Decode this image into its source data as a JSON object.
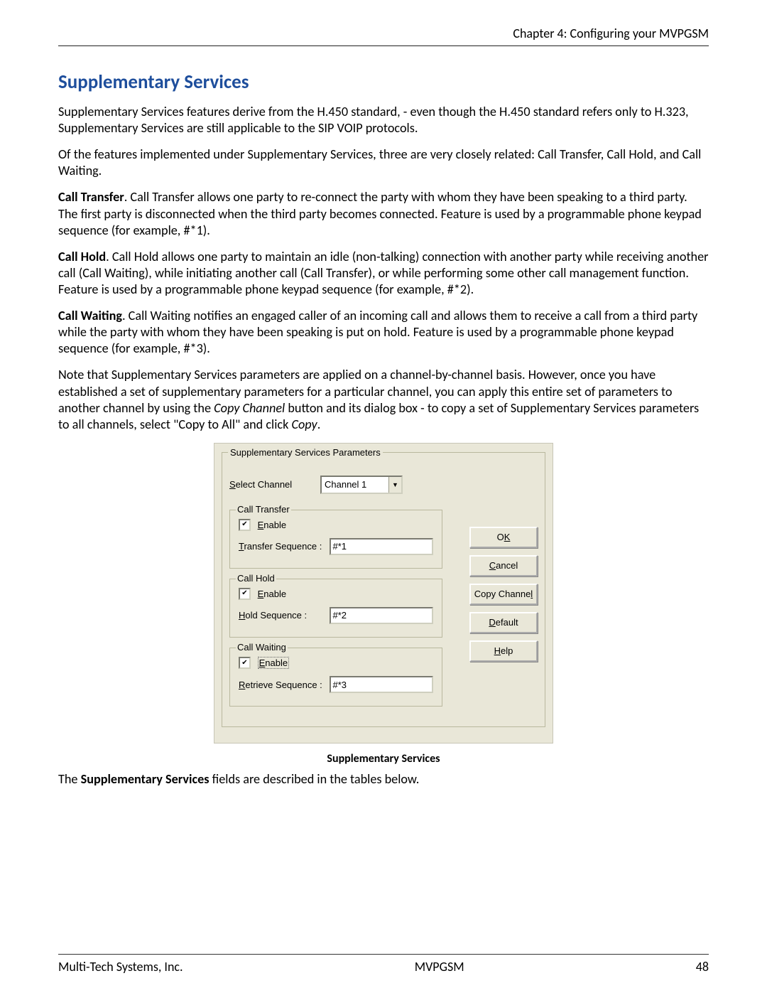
{
  "header": {
    "chapter": "Chapter 4: Configuring your MVPGSM"
  },
  "heading": "Supplementary Services",
  "paragraphs": {
    "p1": "Supplementary Services features derive from the H.450 standard, - even though the H.450 standard refers only to H.323, Supplementary Services are still applicable to the SIP VOIP protocols.",
    "p2": "Of the features implemented under Supplementary Services, three are very closely related:  Call Transfer, Call Hold, and Call Waiting.",
    "p3_lead": "Call Transfer",
    "p3_rest": ".  Call Transfer allows one party to re-connect the party with whom they have been speaking to a third party.  The first party is disconnected when the third party becomes connected.  Feature is used by a programmable phone keypad sequence (for example, #*1).",
    "p4_lead": "Call Hold",
    "p4_rest": ". Call Hold allows one party to maintain an idle (non-talking) connection with another party while receiving another call (Call Waiting), while initiating another call (Call Transfer), or while performing some other call management function.  Feature is used by a programmable phone keypad sequence (for example, #*2).",
    "p5_lead": "Call Waiting",
    "p5_rest": ".  Call Waiting notifies an engaged caller of an incoming call and allows them to receive a call from a third party while the party with whom they have been speaking is put on hold.  Feature is used by a programmable phone keypad sequence (for example, #*3).",
    "p6_a": "Note that Supplementary Services parameters are applied on a channel-by-channel basis.  However, once you have established a set of supplementary parameters for a particular channel, you can apply this entire set of parameters to another channel by using the ",
    "p6_copychannel": "Copy Channel",
    "p6_b": " button and its dialog box - to copy a set of Supplementary Services parameters to all channels, select \"Copy to All\" and click ",
    "p6_copy": "Copy",
    "p6_c": "."
  },
  "dialog": {
    "group_title": "Supplementary Services Parameters",
    "select_channel_label_pre": "S",
    "select_channel_label_post": "elect Channel",
    "select_channel_value": "Channel 1",
    "call_transfer": {
      "title": "Call Transfer",
      "enable_pre": "E",
      "enable_post": "nable",
      "checked": true,
      "seq_label_pre": "T",
      "seq_label_post": "ransfer Sequence :",
      "seq_value": "#*1"
    },
    "call_hold": {
      "title": "Call Hold",
      "enable_pre": "E",
      "enable_post": "nable",
      "checked": true,
      "seq_label_pre": "H",
      "seq_label_post": "old Sequence :",
      "seq_value": "#*2"
    },
    "call_waiting": {
      "title": "Call Waiting",
      "enable_pre": "E",
      "enable_post": "nable",
      "checked": true,
      "seq_label_pre": "R",
      "seq_label_post": "etrieve Sequence :",
      "seq_value": "#*3"
    },
    "buttons": {
      "ok_pre": "O",
      "ok_post": "K",
      "cancel_pre": "C",
      "cancel_post": "ancel",
      "copy_pre": "Copy Channe",
      "copy_post": "l",
      "default_pre": "D",
      "default_post": "efault",
      "help_pre": "H",
      "help_post": "elp"
    }
  },
  "caption": "Supplementary Services",
  "tail_a": "The ",
  "tail_bold": "Supplementary Services",
  "tail_b": " fields are described in the tables below.",
  "footer": {
    "left": "Multi-Tech Systems, Inc.",
    "center": "MVPGSM",
    "right": "48"
  }
}
